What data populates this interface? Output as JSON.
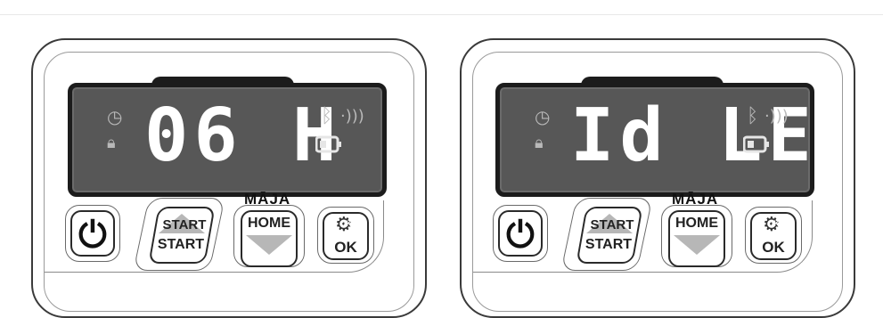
{
  "panels": [
    {
      "display_text": "06 H",
      "bluetooth_icon": "bluetooth-icon",
      "wifi_icon": "signal-icon",
      "battery_icon": "battery-icon",
      "clock_icon": "clock-icon",
      "lock_icon": "lock-icon",
      "power_icon": "power-icon",
      "start_top": "START",
      "start_bottom": "START",
      "maja_label": "MĀJA",
      "home_label": "HOME",
      "ok_top": "OK",
      "ok_bottom": "OK"
    },
    {
      "display_text": "Id LE",
      "bluetooth_icon": "bluetooth-icon",
      "wifi_icon": "signal-icon",
      "battery_icon": "battery-icon",
      "clock_icon": "clock-icon",
      "lock_icon": "lock-icon",
      "power_icon": "power-icon",
      "start_top": "START",
      "start_bottom": "START",
      "maja_label": "MĀJA",
      "home_label": "HOME",
      "ok_top": "OK",
      "ok_bottom": "OK"
    }
  ]
}
